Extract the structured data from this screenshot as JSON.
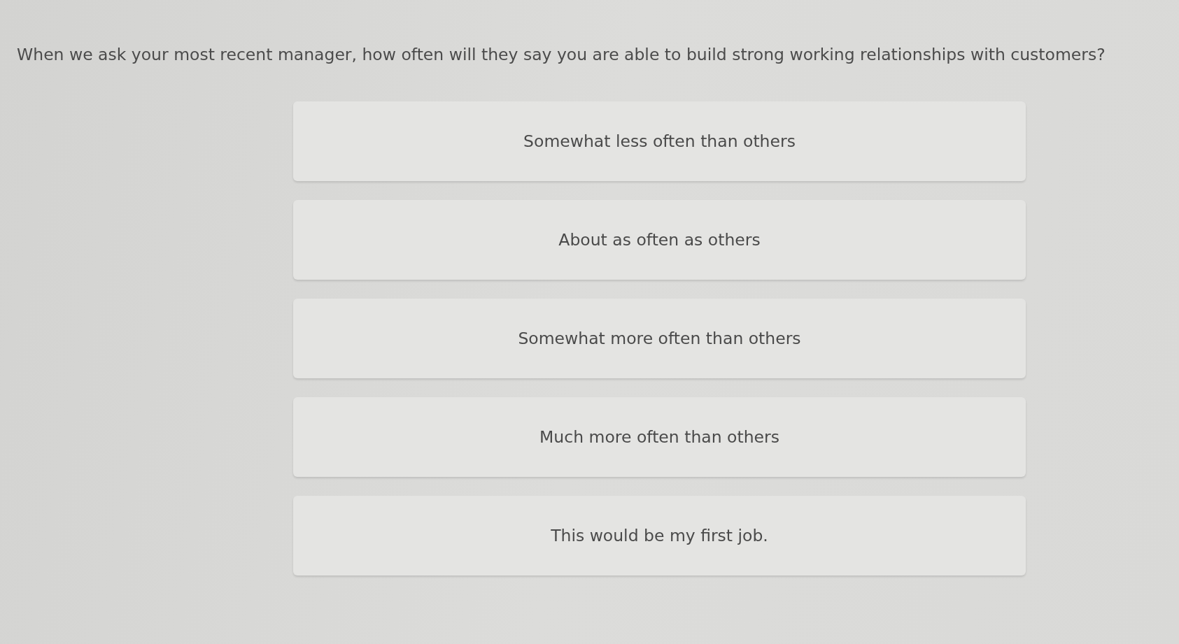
{
  "question": "When we ask your most recent manager, how often will they say you are able to build strong working relationships with customers?",
  "options": [
    {
      "label": "Somewhat less often than others",
      "selected": false
    },
    {
      "label": "About as often as others",
      "selected": false
    },
    {
      "label": "Somewhat more often than others",
      "selected": false
    },
    {
      "label": "Much more often than others",
      "selected": false
    },
    {
      "label": "This would be my first job.",
      "selected": false
    }
  ]
}
